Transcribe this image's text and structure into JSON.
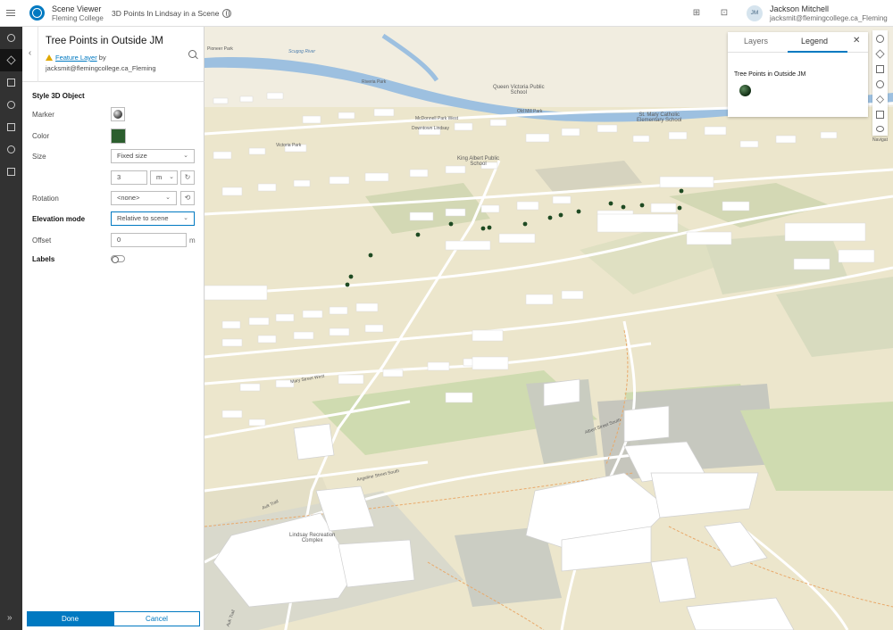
{
  "header": {
    "app_name": "Scene Viewer",
    "org_name": "Fleming College",
    "scene_title": "3D Points In Lindsay in a Scene",
    "user_initials": "JM",
    "user_name": "Jackson Mitchell",
    "user_email": "jacksmit@flemingcollege.ca_Fleming"
  },
  "panel": {
    "layer_title": "Tree Points in Outside JM",
    "layer_type_link": "Feature Layer",
    "by_text": "by",
    "owner": "jacksmit@flemingcollege.ca_Fleming",
    "section_title": "Style 3D Object",
    "marker_label": "Marker",
    "color_label": "Color",
    "color_value": "#2c5e2e",
    "size_label": "Size",
    "size_mode": "Fixed size",
    "size_value": "3",
    "size_unit": "m",
    "rotation_label": "Rotation",
    "rotation_value": "<none>",
    "elevation_label": "Elevation mode",
    "elevation_value": "Relative to scene",
    "offset_label": "Offset",
    "offset_value": "0",
    "offset_unit": "m",
    "labels_label": "Labels",
    "labels_enabled": false,
    "done_label": "Done",
    "cancel_label": "Cancel"
  },
  "legend_widget": {
    "tab_layers": "Layers",
    "tab_legend": "Legend",
    "active_tab": "Legend",
    "layer_name": "Tree Points in Outside JM",
    "symbol_color": "#1e4a22"
  },
  "map": {
    "labels": {
      "pioneer_park": "Pioneer Park",
      "scugog_river": "Scugog River",
      "riveria_park": "Riveria Park",
      "queen_victoria_line1": "Queen Victoria Public",
      "queen_victoria_line2": "School",
      "old_mill_park": "Old Mill Park",
      "mcdonnel_park": "McDonnell Park West",
      "downtown": "Downtown Lindsay",
      "st_mary_line1": "St. Mary Catholic",
      "st_mary_line2": "Elementary School",
      "victoria_park": "Victoria Park",
      "king_albert_line1": "King Albert Public",
      "king_albert_line2": "School",
      "rec_line1": "Lindsay Recreation",
      "rec_line2": "Complex",
      "auk_trail": "Auk Trail",
      "auk_trail_2": "Auk Trail",
      "angeline_south": "Angeline Street South",
      "albert_south": "Albert Street South",
      "mary_street": "Mary Street West",
      "navigation_stub": "Navigat"
    }
  },
  "colors": {
    "accent": "#0079c1",
    "actionbar": "#323232",
    "map_land": "#ece6cc",
    "water": "#9dc0e0",
    "park": "#cfdbb0",
    "tree_point": "#1e4a22"
  },
  "icons": {
    "menu": "hamburger-icon",
    "logo": "scene-viewer-logo-icon",
    "scene_info": "globe-icon",
    "user_avatar": "avatar"
  }
}
